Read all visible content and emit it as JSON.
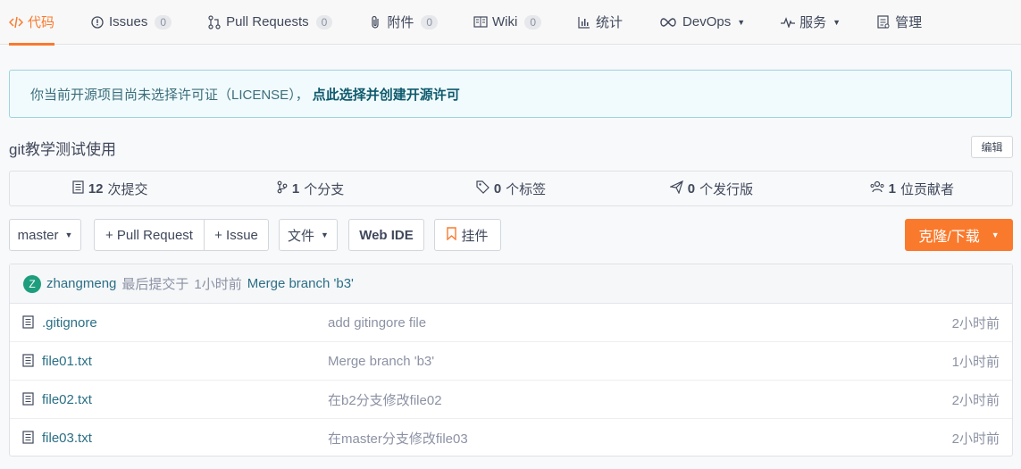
{
  "tabs": [
    {
      "label": "代码",
      "icon": "code-icon",
      "count": null,
      "active": true,
      "caret": false
    },
    {
      "label": "Issues",
      "icon": "issue-icon",
      "count": "0",
      "active": false,
      "caret": false
    },
    {
      "label": "Pull Requests",
      "icon": "pull-request-icon",
      "count": "0",
      "active": false,
      "caret": false
    },
    {
      "label": "附件",
      "icon": "attachment-icon",
      "count": "0",
      "active": false,
      "caret": false
    },
    {
      "label": "Wiki",
      "icon": "wiki-icon",
      "count": "0",
      "active": false,
      "caret": false
    },
    {
      "label": "统计",
      "icon": "stats-icon",
      "count": null,
      "active": false,
      "caret": false
    },
    {
      "label": "DevOps",
      "icon": "devops-icon",
      "count": null,
      "active": false,
      "caret": true
    },
    {
      "label": "服务",
      "icon": "service-icon",
      "count": null,
      "active": false,
      "caret": true
    },
    {
      "label": "管理",
      "icon": "manage-icon",
      "count": null,
      "active": false,
      "caret": false
    }
  ],
  "notice": {
    "text": "你当前开源项目尚未选择许可证（LICENSE），",
    "link": "点此选择并创建开源许可"
  },
  "repo": {
    "description": "git教学测试使用",
    "edit_label": "编辑"
  },
  "stats": [
    {
      "num": "12",
      "label": "次提交",
      "icon": "commit-icon"
    },
    {
      "num": "1",
      "label": "个分支",
      "icon": "branch-icon"
    },
    {
      "num": "0",
      "label": "个标签",
      "icon": "tag-icon"
    },
    {
      "num": "0",
      "label": "个发行版",
      "icon": "release-icon"
    },
    {
      "num": "1",
      "label": "位贡献者",
      "icon": "contributors-icon"
    }
  ],
  "toolbar": {
    "branch": "master",
    "pull_request": "+ Pull Request",
    "issue": "+ Issue",
    "file": "文件",
    "webide": "Web IDE",
    "widget": "挂件",
    "clone": "克隆/下载"
  },
  "commit": {
    "avatar_letter": "Z",
    "user": "zhangmeng",
    "action": "最后提交于",
    "time": "1小时前",
    "message": "Merge branch 'b3'"
  },
  "files": [
    {
      "name": ".gitignore",
      "message": "add gitingore file",
      "time": "2小时前"
    },
    {
      "name": "file01.txt",
      "message": "Merge branch 'b3'",
      "time": "1小时前"
    },
    {
      "name": "file02.txt",
      "message": "在b2分支修改file02",
      "time": "2小时前"
    },
    {
      "name": "file03.txt",
      "message": "在master分支修改file03",
      "time": "2小时前"
    }
  ],
  "colors": {
    "accent": "#fa7a2d",
    "link": "#2a6f86",
    "muted": "#8c92a4",
    "notice_bg": "#f1fbfd",
    "avatar": "#1e9e7d"
  }
}
